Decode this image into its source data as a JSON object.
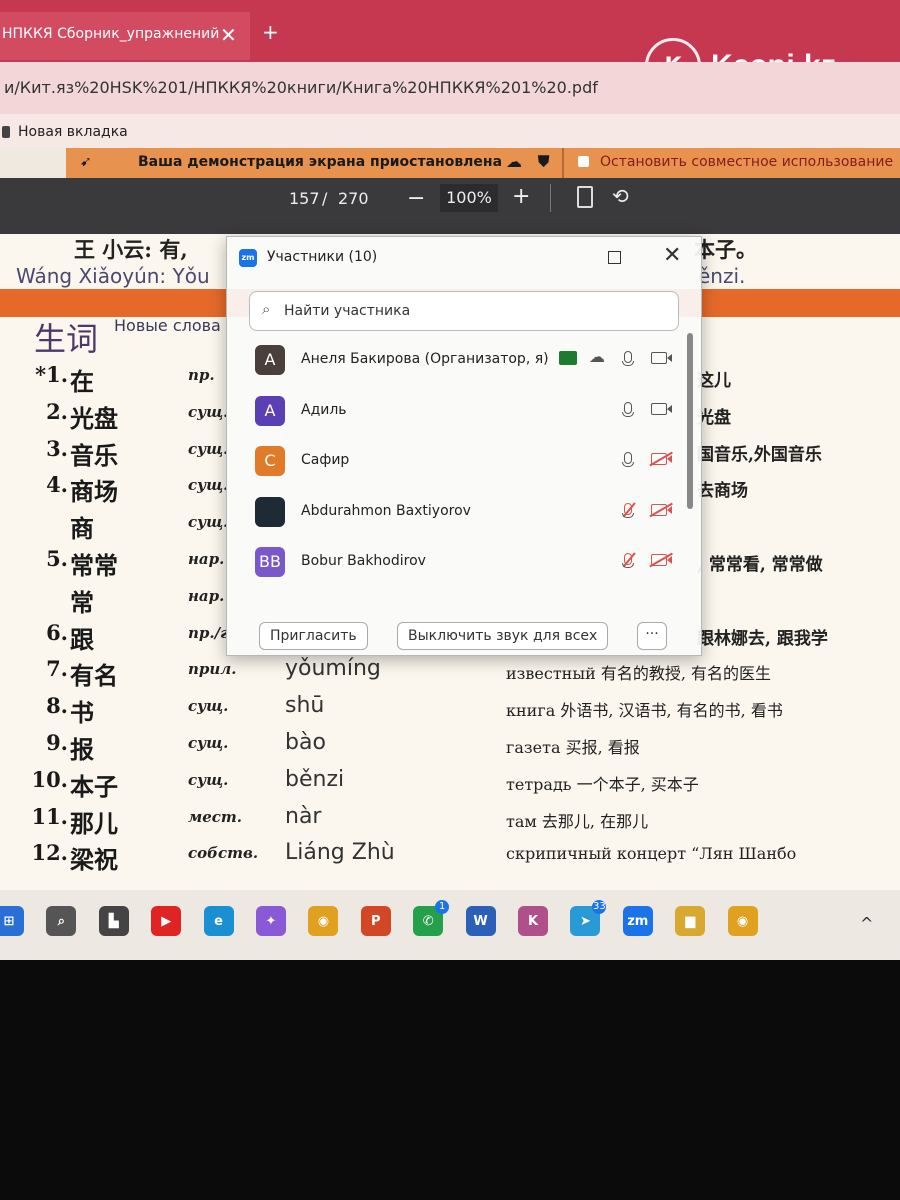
{
  "browser": {
    "tab_title": "НПККЯ Сборник_упражнений",
    "tab_close": "✕",
    "new_tab": "+",
    "url": "и/Кит.яз%20HSK%201/НПККЯ%20книги/Книга%20НПККЯ%201%20.pdf",
    "bookmark": "Новая вкладка"
  },
  "watermark": {
    "text": "Kaspi.kz"
  },
  "screenshare": {
    "status": "Ваша демонстрация экрана приостановлена",
    "stop": "Остановить совместное использование"
  },
  "pdf": {
    "page_current": "157",
    "page_sep": "/",
    "page_total": "270",
    "zoom": "100%",
    "zoom_minus": "−",
    "zoom_plus": "+"
  },
  "page": {
    "dialog_cn": "王 小云:  有,",
    "dialog_cn_end": "本子。",
    "dialog_pinyin": "Wáng Xiǎoyún:   Yǒu",
    "dialog_pinyin_end": "ěnzi.",
    "vocab_title": "生词",
    "vocab_subtitle": "Новые слова",
    "vocab": [
      {
        "num": "*1.",
        "word": "在",
        "pos": "пр.",
        "pinyin": "",
        "meaning": "",
        "meaning_right": "这儿"
      },
      {
        "num": "2.",
        "word": "光盘",
        "pos": "сущ.",
        "pinyin": "",
        "meaning": "",
        "meaning_right": "光盘"
      },
      {
        "num": "3.",
        "word": "音乐",
        "pos": "сущ.",
        "pinyin": "",
        "meaning": "",
        "meaning_right": "国音乐,外国音乐"
      },
      {
        "num": "4.",
        "word": "商场",
        "pos": "сущ.",
        "pinyin": "",
        "meaning": "",
        "meaning_right": "去商场"
      },
      {
        "num": "",
        "word": "商",
        "pos": "сущ.",
        "pinyin": "",
        "meaning": "",
        "meaning_right": ""
      },
      {
        "num": "5.",
        "word": "常常",
        "pos": "нар.",
        "pinyin": "",
        "meaning": "",
        "meaning_right": ", 常常看, 常常做"
      },
      {
        "num": "",
        "word": "常",
        "pos": "нар.",
        "pinyin": "",
        "meaning": "",
        "meaning_right": ""
      },
      {
        "num": "6.",
        "word": "跟",
        "pos": "пр./г",
        "pinyin": "",
        "meaning": "",
        "meaning_right": "跟林娜去, 跟我学"
      },
      {
        "num": "7.",
        "word": "有名",
        "pos": "прил.",
        "pinyin": "yǒumíng",
        "meaning": "известный  有名的教授, 有名的医生",
        "meaning_right": ""
      },
      {
        "num": "8.",
        "word": "书",
        "pos": "сущ.",
        "pinyin": "shū",
        "meaning": "книга  外语书, 汉语书, 有名的书, 看书",
        "meaning_right": ""
      },
      {
        "num": "9.",
        "word": "报",
        "pos": "сущ.",
        "pinyin": "bào",
        "meaning": "газета  买报, 看报",
        "meaning_right": ""
      },
      {
        "num": "10.",
        "word": "本子",
        "pos": "сущ.",
        "pinyin": "běnzi",
        "meaning": "тетрадь  一个本子, 买本子",
        "meaning_right": ""
      },
      {
        "num": "11.",
        "word": "那儿",
        "pos": "мест.",
        "pinyin": "nàr",
        "meaning": "там  去那儿, 在那儿",
        "meaning_right": ""
      },
      {
        "num": "12.",
        "word": "梁祝",
        "pos": "собств.",
        "pinyin": "Liáng Zhù",
        "meaning": "скрипичный концерт “Лян Шанбо",
        "meaning_right": ""
      }
    ]
  },
  "zoom_dialog": {
    "logo": "zm",
    "title": "Участники (10)",
    "search_placeholder": "Найти участника",
    "participants": [
      {
        "initials": "A",
        "name": "Анеля Бакирова (Организатор, я)",
        "avatar_color": "#4a3f3a",
        "mic_muted": false,
        "cam_off": false,
        "sharing": true
      },
      {
        "initials": "A",
        "name": "Адиль",
        "avatar_color": "#5b3fb5",
        "mic_muted": false,
        "cam_off": false,
        "sharing": false
      },
      {
        "initials": "C",
        "name": "Сафир",
        "avatar_color": "#e07b2a",
        "mic_muted": false,
        "cam_off": true,
        "sharing": false
      },
      {
        "initials": "",
        "name": "Abdurahmon Baxtiyorov",
        "avatar_color": "#1e2a35",
        "mic_muted": true,
        "cam_off": true,
        "sharing": false
      },
      {
        "initials": "BB",
        "name": "Bobur Bakhodirov",
        "avatar_color": "#7b58c9",
        "mic_muted": true,
        "cam_off": true,
        "sharing": false
      }
    ],
    "invite": "Пригласить",
    "mute_all": "Выключить звук для всех",
    "more": "···"
  },
  "taskbar": {
    "icons": [
      {
        "name": "windows-start-icon",
        "glyph": "⊞",
        "color": "#2a6fd6",
        "badge": ""
      },
      {
        "name": "search-icon",
        "glyph": "⌕",
        "color": "#555555",
        "badge": ""
      },
      {
        "name": "task-view-icon",
        "glyph": "▙",
        "color": "#444444",
        "badge": ""
      },
      {
        "name": "youtube-icon",
        "glyph": "▶",
        "color": "#e02424",
        "badge": ""
      },
      {
        "name": "edge-icon",
        "glyph": "e",
        "color": "#1a8fd1",
        "badge": ""
      },
      {
        "name": "copilot-icon",
        "glyph": "✦",
        "color": "#8a5ad6",
        "badge": ""
      },
      {
        "name": "chrome-icon",
        "glyph": "◉",
        "color": "#e0a020",
        "badge": ""
      },
      {
        "name": "powerpoint-icon",
        "glyph": "P",
        "color": "#d24726",
        "badge": ""
      },
      {
        "name": "whatsapp-icon",
        "glyph": "✆",
        "color": "#25a04a",
        "badge": "1"
      },
      {
        "name": "word-icon",
        "glyph": "W",
        "color": "#2b5fb8",
        "badge": ""
      },
      {
        "name": "app-icon",
        "glyph": "K",
        "color": "#b0508a",
        "badge": ""
      },
      {
        "name": "telegram-icon",
        "glyph": "➤",
        "color": "#2a9ad6",
        "badge": "33"
      },
      {
        "name": "zoom-icon",
        "glyph": "zm",
        "color": "#1a73e8",
        "badge": ""
      },
      {
        "name": "file-explorer-icon",
        "glyph": "▆",
        "color": "#d8a830",
        "badge": ""
      },
      {
        "name": "chrome-icon-2",
        "glyph": "◉",
        "color": "#e0a020",
        "badge": ""
      }
    ],
    "chevron": "^"
  }
}
